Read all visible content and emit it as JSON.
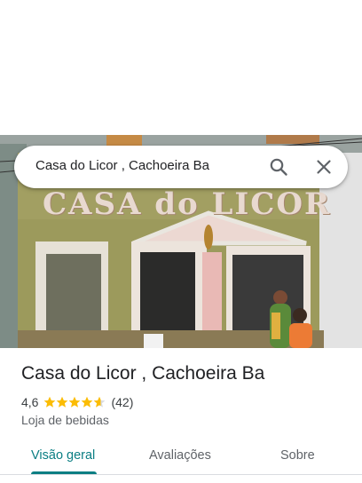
{
  "search": {
    "query": "Casa do Licor , Cachoeira Ba"
  },
  "photo": {
    "sign_text": "CASA do LICOR"
  },
  "place": {
    "name": "Casa do Licor , Cachoeira Ba",
    "rating": "4,6",
    "rating_value": 4.6,
    "review_count": "(42)",
    "category": "Loja de bebidas"
  },
  "tabs": [
    {
      "label": "Visão geral",
      "active": true
    },
    {
      "label": "Avaliações",
      "active": false
    },
    {
      "label": "Sobre",
      "active": false
    }
  ],
  "colors": {
    "accent": "#0b7e83",
    "star": "#fbbc04",
    "text": "#202124"
  },
  "icons": {
    "search": "search-icon",
    "close": "close-icon",
    "star": "star-icon"
  }
}
